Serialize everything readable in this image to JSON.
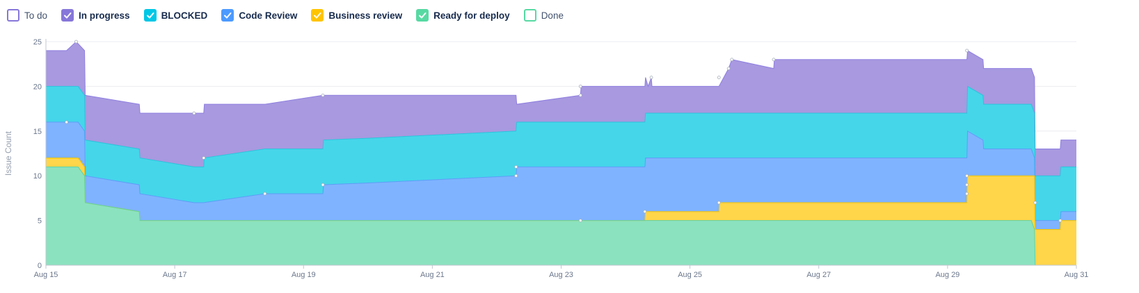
{
  "chart_data": {
    "type": "area",
    "title": "",
    "xlabel": "",
    "ylabel": "Issue Count",
    "ylim": [
      0,
      25
    ],
    "yticks": [
      0,
      5,
      10,
      15,
      20,
      25
    ],
    "xlim": [
      15,
      31
    ],
    "xticks": [
      {
        "label": "Aug 15",
        "x": 15
      },
      {
        "label": "Aug 17",
        "x": 17
      },
      {
        "label": "Aug 19",
        "x": 19
      },
      {
        "label": "Aug 21",
        "x": 21
      },
      {
        "label": "Aug 23",
        "x": 23
      },
      {
        "label": "Aug 25",
        "x": 25
      },
      {
        "label": "Aug 27",
        "x": 27
      },
      {
        "label": "Aug 29",
        "x": 29
      },
      {
        "label": "Aug 31",
        "x": 31
      }
    ],
    "grid": true,
    "legend_position": "top-left",
    "legend": [
      {
        "name": "To do",
        "color": "#8777d9",
        "checked": false
      },
      {
        "name": "In progress",
        "color": "#8777d9",
        "checked": true
      },
      {
        "name": "BLOCKED",
        "color": "#00c7e6",
        "checked": true
      },
      {
        "name": "Code Review",
        "color": "#4c9aff",
        "checked": true
      },
      {
        "name": "Business review",
        "color": "#ffc400",
        "checked": true
      },
      {
        "name": "Ready for deploy",
        "color": "#57d9a3",
        "checked": true
      },
      {
        "name": "Done",
        "color": "#57d9a3",
        "checked": false
      }
    ],
    "series": [
      {
        "name": "In progress",
        "color": "#a899e0",
        "stroke": "#8f7ee0",
        "points": [
          [
            15,
            24
          ],
          [
            15.32,
            24
          ],
          [
            15.47,
            25
          ],
          [
            15.6,
            24
          ],
          [
            15.61,
            19
          ],
          [
            16.45,
            18
          ],
          [
            16.46,
            17
          ],
          [
            17.3,
            17
          ],
          [
            17.45,
            17
          ],
          [
            17.46,
            18
          ],
          [
            18.4,
            18
          ],
          [
            19.3,
            19
          ],
          [
            20,
            19
          ],
          [
            22.3,
            19
          ],
          [
            22.31,
            18
          ],
          [
            23.3,
            19
          ],
          [
            23.31,
            20
          ],
          [
            24.3,
            20
          ],
          [
            24.31,
            21
          ],
          [
            24.35,
            20
          ],
          [
            24.4,
            21
          ],
          [
            24.41,
            20
          ],
          [
            25.45,
            20
          ],
          [
            25.6,
            22
          ],
          [
            25.65,
            23
          ],
          [
            26.3,
            22
          ],
          [
            26.31,
            23
          ],
          [
            29.3,
            23
          ],
          [
            29.31,
            24
          ],
          [
            29.55,
            23
          ],
          [
            29.56,
            22
          ],
          [
            30.3,
            22
          ],
          [
            30.35,
            21
          ],
          [
            30.36,
            13
          ],
          [
            30.75,
            13
          ],
          [
            30.76,
            14
          ],
          [
            31,
            14
          ]
        ]
      },
      {
        "name": "BLOCKED",
        "color": "#45d6ea",
        "stroke": "#2cc4dc",
        "points": [
          [
            15,
            20
          ],
          [
            15.5,
            20
          ],
          [
            15.6,
            19
          ],
          [
            15.61,
            14
          ],
          [
            16.45,
            13
          ],
          [
            16.46,
            12
          ],
          [
            17.3,
            11
          ],
          [
            17.45,
            11
          ],
          [
            17.46,
            12
          ],
          [
            18.4,
            13
          ],
          [
            19.3,
            13
          ],
          [
            19.31,
            14
          ],
          [
            20,
            14.2
          ],
          [
            22.3,
            15
          ],
          [
            22.31,
            16
          ],
          [
            24.3,
            16
          ],
          [
            24.31,
            17
          ],
          [
            29.3,
            17
          ],
          [
            29.31,
            20
          ],
          [
            29.55,
            19
          ],
          [
            29.56,
            18
          ],
          [
            30.3,
            18
          ],
          [
            30.35,
            17
          ],
          [
            30.36,
            10
          ],
          [
            30.75,
            10
          ],
          [
            30.76,
            11
          ],
          [
            31,
            11
          ]
        ]
      },
      {
        "name": "Code Review",
        "color": "#7fb3ff",
        "stroke": "#5d9ef7",
        "points": [
          [
            15,
            16
          ],
          [
            15.5,
            16
          ],
          [
            15.6,
            15
          ],
          [
            15.61,
            10
          ],
          [
            16.45,
            9
          ],
          [
            16.46,
            8
          ],
          [
            17.3,
            7
          ],
          [
            17.45,
            7
          ],
          [
            18.4,
            8
          ],
          [
            19.3,
            8
          ],
          [
            19.31,
            9
          ],
          [
            20,
            9.2
          ],
          [
            22.3,
            10
          ],
          [
            22.31,
            11
          ],
          [
            24.3,
            11
          ],
          [
            24.31,
            12
          ],
          [
            29.3,
            12
          ],
          [
            29.31,
            15
          ],
          [
            29.55,
            14
          ],
          [
            29.56,
            13
          ],
          [
            30.3,
            13
          ],
          [
            30.35,
            12
          ],
          [
            30.36,
            5
          ],
          [
            30.75,
            5
          ],
          [
            30.76,
            6
          ],
          [
            31,
            6
          ]
        ]
      },
      {
        "name": "Business review",
        "color": "#ffd54a",
        "stroke": "#f5c400",
        "points": [
          [
            15,
            12
          ],
          [
            15.5,
            12
          ],
          [
            15.6,
            11
          ],
          [
            15.61,
            7
          ],
          [
            16.45,
            6
          ],
          [
            16.46,
            5
          ],
          [
            24.3,
            5
          ],
          [
            24.31,
            6
          ],
          [
            25.45,
            6
          ],
          [
            25.46,
            7
          ],
          [
            29.3,
            7
          ],
          [
            29.31,
            10
          ],
          [
            30.35,
            10
          ],
          [
            30.36,
            4
          ],
          [
            30.75,
            4
          ],
          [
            30.76,
            5
          ],
          [
            31,
            5
          ]
        ]
      },
      {
        "name": "Ready for deploy",
        "color": "#8be2bf",
        "stroke": "#5fd3a2",
        "points": [
          [
            15,
            11
          ],
          [
            15.5,
            11
          ],
          [
            15.6,
            10
          ],
          [
            15.61,
            7
          ],
          [
            16.45,
            6
          ],
          [
            16.46,
            5
          ],
          [
            30.3,
            5
          ],
          [
            30.35,
            4
          ],
          [
            30.36,
            0
          ],
          [
            31,
            0
          ]
        ]
      }
    ],
    "markers": [
      [
        15.47,
        25
      ],
      [
        15.32,
        16
      ],
      [
        17.3,
        17
      ],
      [
        17.45,
        12
      ],
      [
        18.4,
        8
      ],
      [
        19.3,
        19
      ],
      [
        19.3,
        9
      ],
      [
        22.3,
        11
      ],
      [
        22.3,
        10
      ],
      [
        23.3,
        19
      ],
      [
        23.3,
        20
      ],
      [
        23.3,
        5
      ],
      [
        24.3,
        6
      ],
      [
        24.4,
        21
      ],
      [
        25.45,
        21
      ],
      [
        25.6,
        22
      ],
      [
        25.65,
        23
      ],
      [
        25.45,
        7
      ],
      [
        26.3,
        23
      ],
      [
        29.3,
        24
      ],
      [
        29.3,
        10
      ],
      [
        29.3,
        9
      ],
      [
        29.3,
        8
      ],
      [
        30.36,
        7
      ],
      [
        30.75,
        5
      ]
    ]
  }
}
